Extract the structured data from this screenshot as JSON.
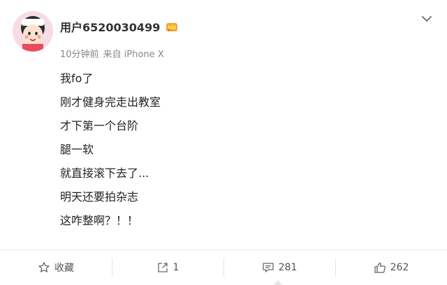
{
  "post": {
    "username": "用户6520030499",
    "time": "10分钟前",
    "source": "来自 iPhone X",
    "lines": [
      "我fo了",
      "刚才健身完走出教室",
      "才下第一个台阶",
      "腿一软",
      "就直接滚下去了...",
      "明天还要拍杂志",
      "这咋整啊？！！"
    ]
  },
  "actions": {
    "favorite_label": "收藏",
    "repost_count": "1",
    "comment_count": "281",
    "like_count": "262"
  },
  "icons": {
    "favorite": "star-icon",
    "repost": "repost-icon",
    "comment": "comment-icon",
    "like": "thumbs-up-icon",
    "menu": "chevron-down-icon",
    "badge": "vip-crown-icon"
  },
  "colors": {
    "background": "#ffffff",
    "text": "#222222",
    "meta": "#888888",
    "divider": "#e6e6e6",
    "icon": "#666666"
  }
}
